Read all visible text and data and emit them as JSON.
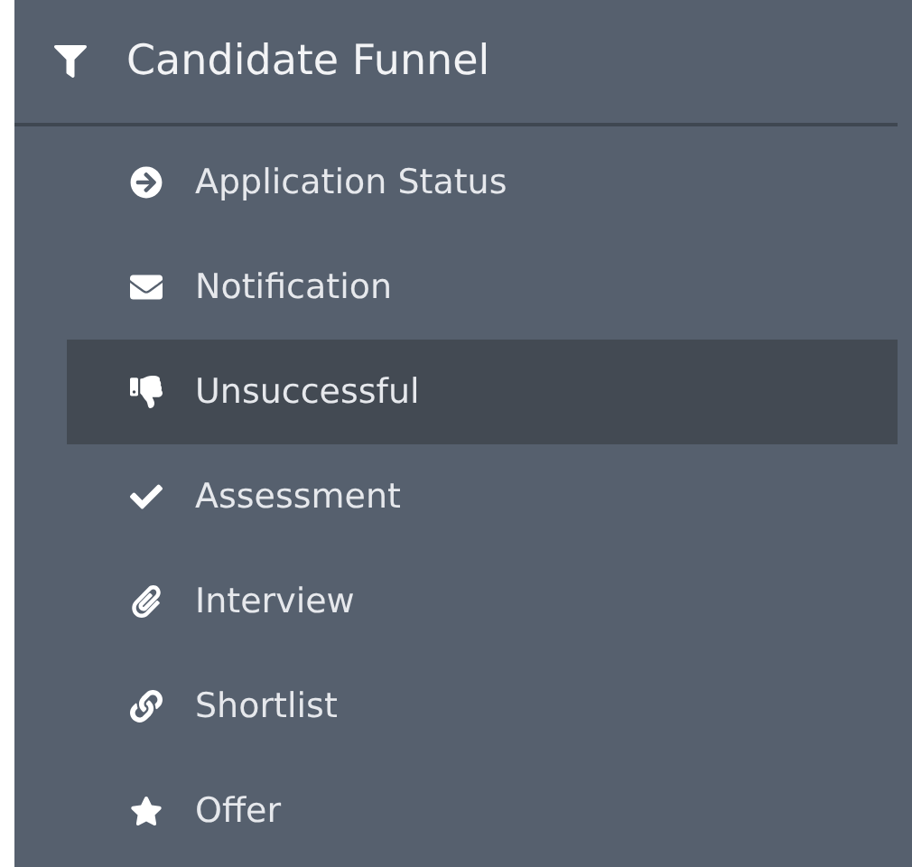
{
  "header": {
    "title": "Candidate Funnel"
  },
  "items": [
    {
      "label": "Application Status",
      "selected": false
    },
    {
      "label": "Notification",
      "selected": false
    },
    {
      "label": "Unsuccessful",
      "selected": true
    },
    {
      "label": "Assessment",
      "selected": false
    },
    {
      "label": "Interview",
      "selected": false
    },
    {
      "label": "Shortlist",
      "selected": false
    },
    {
      "label": "Offer",
      "selected": false
    }
  ]
}
